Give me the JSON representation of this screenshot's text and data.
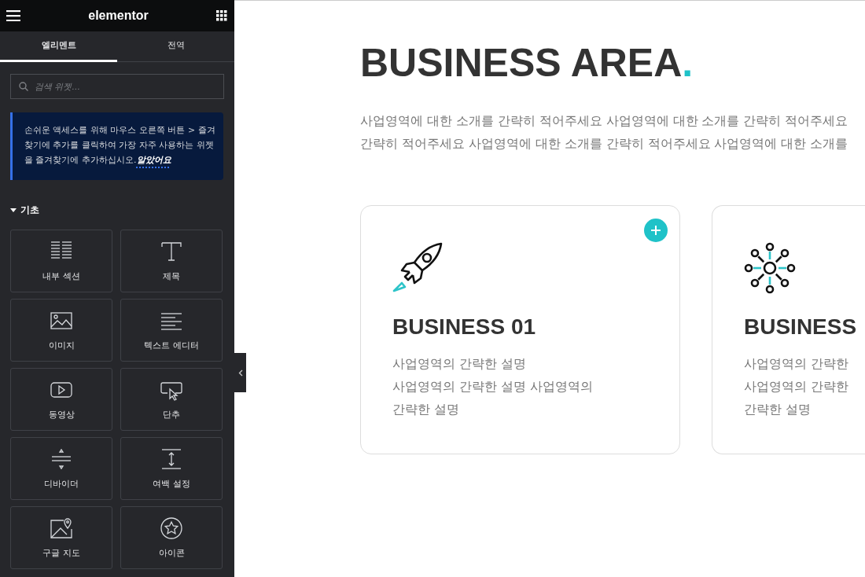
{
  "header": {
    "logo": "elementor"
  },
  "tabs": [
    {
      "label": "엘리멘트",
      "selected": true
    },
    {
      "label": "전역",
      "selected": false
    }
  ],
  "search": {
    "placeholder": "검색 위젯..."
  },
  "notice": {
    "text": "손쉬운 액세스를 위해 마우스 오른쪽 버튼 > 즐겨찾기에 추가를 클릭하여 가장 자주 사용하는 위젯을 즐겨찾기에 추가하십시오.",
    "link": "알았어요"
  },
  "category": {
    "title": "기초",
    "expanded": true
  },
  "widgets": [
    {
      "label": "내부 섹션",
      "kind": "columns"
    },
    {
      "label": "제목",
      "kind": "heading"
    },
    {
      "label": "이미지",
      "kind": "image"
    },
    {
      "label": "텍스트 에디터",
      "kind": "text"
    },
    {
      "label": "동영상",
      "kind": "video"
    },
    {
      "label": "단추",
      "kind": "button"
    },
    {
      "label": "디바이더",
      "kind": "divider"
    },
    {
      "label": "여백 설정",
      "kind": "spacer"
    },
    {
      "label": "구글 지도",
      "kind": "map"
    },
    {
      "label": "아이콘",
      "kind": "icon"
    }
  ],
  "section": {
    "title": "BUSINESS AREA",
    "title_mark": ".",
    "intro_lines": [
      "사업영역에 대한 소개를 간략히 적어주세요 사업영역에 대한 소개를 간략히 적어주세요",
      "간략히 적어주세요 사업영역에 대한 소개를 간략히 적어주세요 사업영역에 대한 소개를"
    ]
  },
  "cards": [
    {
      "title": "BUSINESS 01",
      "kind": "rocket",
      "lines": [
        "사업영역의 간략한 설명",
        "사업영역의 간략한 설명 사업영역의",
        "간략한 설명"
      ]
    },
    {
      "title": "BUSINESS",
      "kind": "network",
      "lines": [
        "사업영역의 간략한",
        "사업영역의 간략한",
        "간략한 설명"
      ]
    }
  ]
}
